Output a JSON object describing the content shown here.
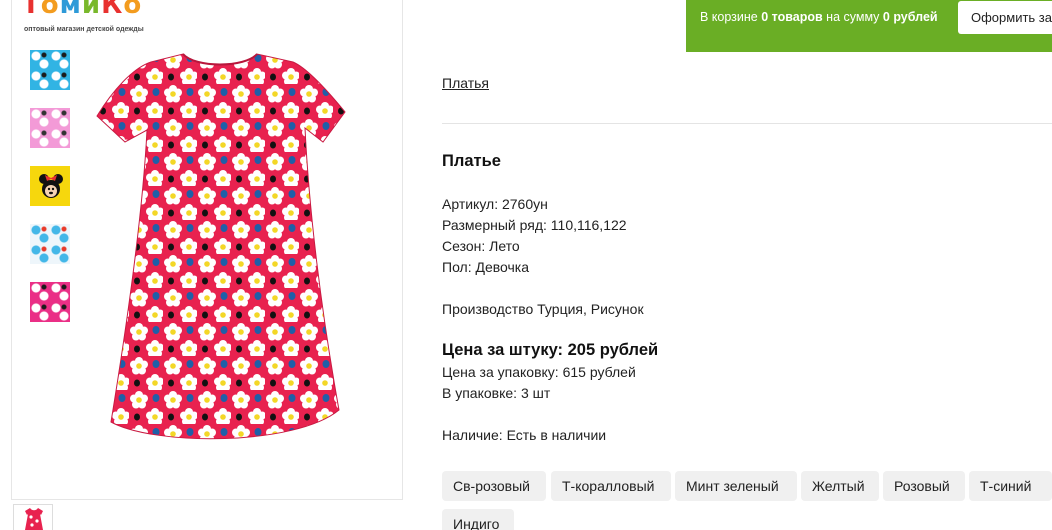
{
  "logo": {
    "letters": [
      "Т",
      "о",
      "м",
      "и",
      "К",
      "о"
    ],
    "tagline": "оптовый магазин детской одежды"
  },
  "cart": {
    "prefix": "В корзине ",
    "items": "0 товаров",
    "middle": " на сумму ",
    "sum": "0 рублей",
    "checkout_label": "Оформить заказ"
  },
  "breadcrumb": "Платья",
  "product": {
    "title": "Платье",
    "article": "Артикул: 2760ун",
    "sizes": "Размерный ряд: 110,116,122",
    "season": "Сезон: Лето",
    "gender": "Пол: Девочка",
    "production": "Производство Турция, Рисунок",
    "price_unit": "Цена за штуку: 205 рублей",
    "price_pack": "Цена за упаковку: 615 рублей",
    "pack_qty": "В упаковке: 3 шт",
    "availability": "Наличие: Есть в наличии"
  },
  "colors": [
    "Св-розовый",
    "Т-коралловый",
    "Минт зеленый",
    "Желтый",
    "Розовый",
    "Т-синий",
    "Индиго"
  ],
  "palette": {
    "cart_green": "#6aae25",
    "dress_red": "#e8224f",
    "chip_bg": "#f0f0f0"
  },
  "icons": [
    "dress-photo",
    "thumbnail-pattern",
    "minnie-mouse-thumbnail"
  ]
}
